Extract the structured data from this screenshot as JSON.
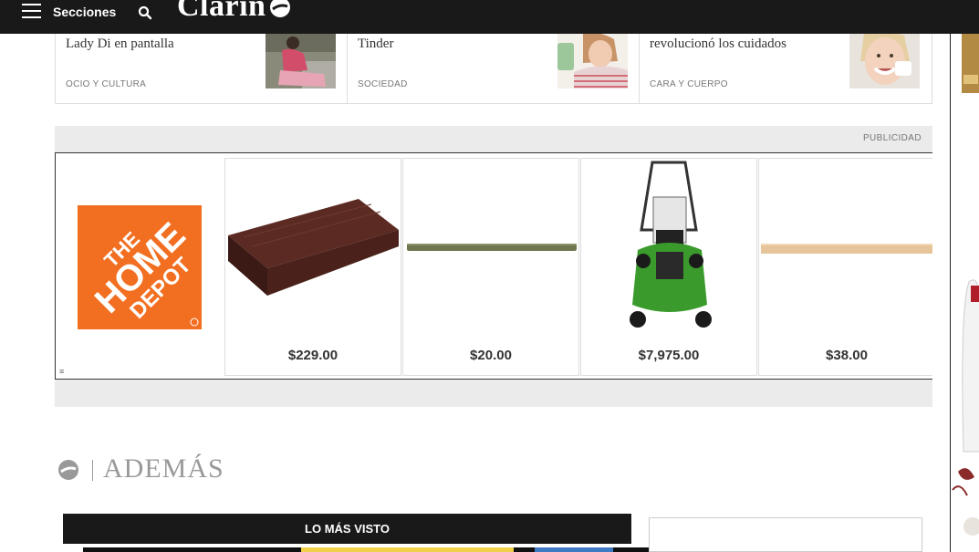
{
  "header": {
    "menu_label": "Secciones",
    "logo_text": "Clarín"
  },
  "cards": [
    {
      "title": "Lady Di en pantalla",
      "category": "OCIO Y CULTURA"
    },
    {
      "title": "Tinder",
      "category": "SOCIEDAD"
    },
    {
      "title": "revolucionó los cuidados",
      "category": "CARA Y CUERPO"
    }
  ],
  "ad": {
    "label": "PUBLICIDAD",
    "brand": "The Home Depot",
    "brand_color": "#f26f21",
    "products": [
      {
        "price": "$229.00"
      },
      {
        "price": "$20.00"
      },
      {
        "price": "$7,975.00"
      },
      {
        "price": "$38.00"
      }
    ]
  },
  "section": {
    "title": "ADEMÁS",
    "most_viewed": "LO MÁS VISTO"
  },
  "icons": [
    "menu-icon",
    "search-icon",
    "clarin-logo-icon",
    "home-depot-logo",
    "ademas-icon"
  ]
}
